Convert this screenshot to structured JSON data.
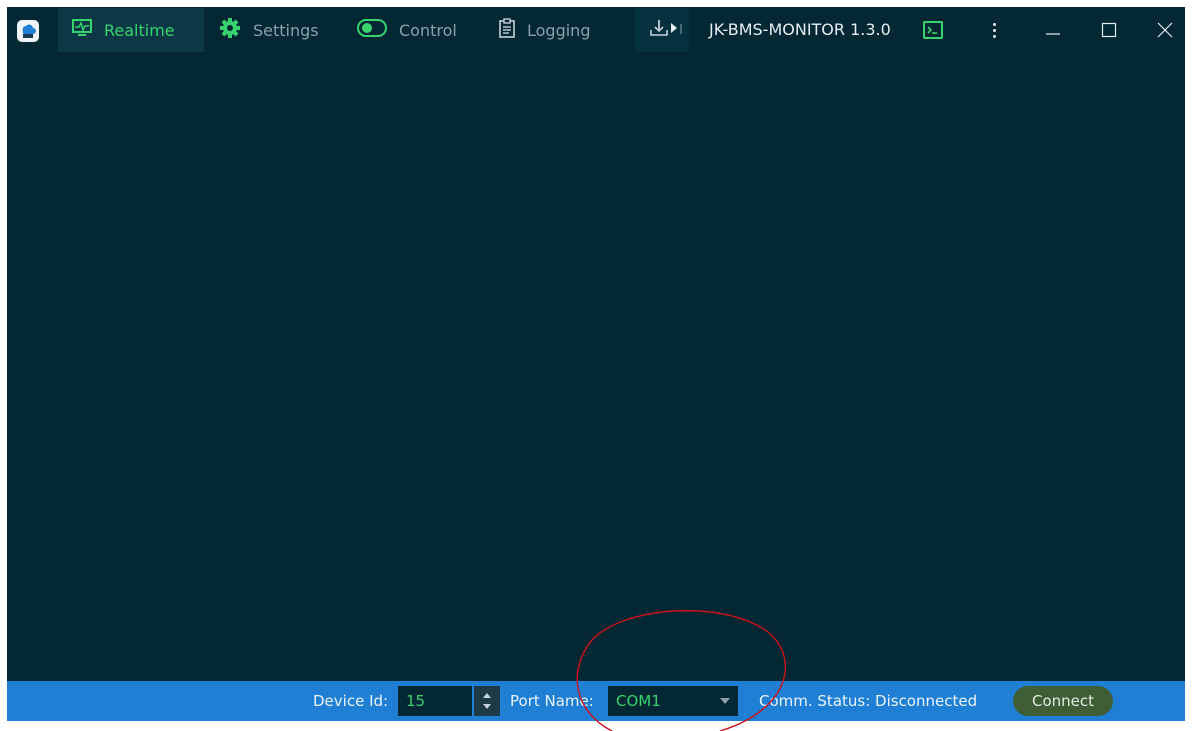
{
  "window": {
    "title": "JK-BMS-MONITOR 1.3.0"
  },
  "tabs": [
    {
      "label": "Realtime",
      "icon": "monitor-pulse-icon",
      "active": true
    },
    {
      "label": "Settings",
      "icon": "gear-icon",
      "active": false
    },
    {
      "label": "Control",
      "icon": "toggle-icon",
      "active": false
    },
    {
      "label": "Logging",
      "icon": "clipboard-icon",
      "active": false
    }
  ],
  "status_bar": {
    "device_id_label": "Device Id:",
    "device_id_value": "15",
    "port_name_label": "Port Name:",
    "port_name_value": "COM1",
    "comm_status": "Comm. Status: Disconnected",
    "connect_label": "Connect"
  },
  "colors": {
    "background": "#032733",
    "accent_green": "#36d36e",
    "status_bar_blue": "#1e7fd4",
    "connect_button": "#3f5e36",
    "annotation_red": "#d0101a"
  }
}
